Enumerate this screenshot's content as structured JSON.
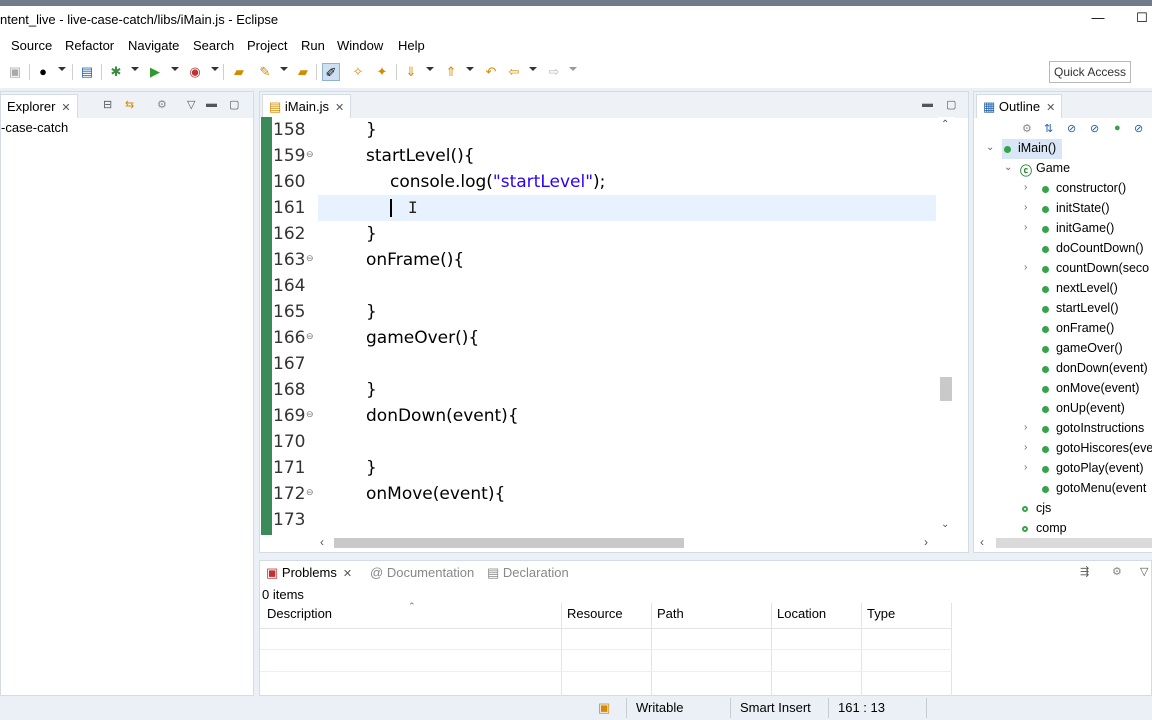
{
  "window": {
    "title": "ntent_live - live-case-catch/libs/iMain.js - Eclipse",
    "minimize_glyph": "—",
    "maximize_glyph": "☐"
  },
  "menu": [
    "Source",
    "Refactor",
    "Navigate",
    "Search",
    "Project",
    "Run",
    "Window",
    "Help"
  ],
  "toolbar": {
    "quick_access": "Quick Access"
  },
  "explorer": {
    "tab_label": "Explorer",
    "tree_item": "-case-catch"
  },
  "editor": {
    "tab_label": "iMain.js",
    "lines": [
      {
        "num": "158",
        "indent": 2,
        "parts": [
          {
            "t": "}"
          }
        ],
        "fold": false
      },
      {
        "num": "159",
        "indent": 2,
        "parts": [
          {
            "t": "startLevel(){"
          }
        ],
        "fold": true
      },
      {
        "num": "160",
        "indent": 3,
        "parts": [
          {
            "t": "console.log("
          },
          {
            "t": "\"startLevel\"",
            "s": true
          },
          {
            "t": ");"
          }
        ],
        "fold": false
      },
      {
        "num": "161",
        "indent": 3,
        "parts": [
          {
            "t": ""
          }
        ],
        "fold": false,
        "current": true
      },
      {
        "num": "162",
        "indent": 2,
        "parts": [
          {
            "t": "}"
          }
        ],
        "fold": false
      },
      {
        "num": "163",
        "indent": 2,
        "parts": [
          {
            "t": "onFrame(){"
          }
        ],
        "fold": true
      },
      {
        "num": "164",
        "indent": 2,
        "parts": [
          {
            "t": ""
          }
        ],
        "fold": false
      },
      {
        "num": "165",
        "indent": 2,
        "parts": [
          {
            "t": "}"
          }
        ],
        "fold": false
      },
      {
        "num": "166",
        "indent": 2,
        "parts": [
          {
            "t": "gameOver(){"
          }
        ],
        "fold": true
      },
      {
        "num": "167",
        "indent": 2,
        "parts": [
          {
            "t": ""
          }
        ],
        "fold": false
      },
      {
        "num": "168",
        "indent": 2,
        "parts": [
          {
            "t": "}"
          }
        ],
        "fold": false
      },
      {
        "num": "169",
        "indent": 2,
        "parts": [
          {
            "t": "donDown(event){"
          }
        ],
        "fold": true
      },
      {
        "num": "170",
        "indent": 2,
        "parts": [
          {
            "t": ""
          }
        ],
        "fold": false
      },
      {
        "num": "171",
        "indent": 2,
        "parts": [
          {
            "t": "}"
          }
        ],
        "fold": false
      },
      {
        "num": "172",
        "indent": 2,
        "parts": [
          {
            "t": "onMove(event){"
          }
        ],
        "fold": true
      },
      {
        "num": "173",
        "indent": 2,
        "parts": [
          {
            "t": ""
          }
        ],
        "fold": false
      }
    ]
  },
  "outline": {
    "tab_label": "Outline",
    "items": [
      {
        "label": "iMain()",
        "level": 0,
        "expand": "down",
        "selected": true
      },
      {
        "label": "Game",
        "level": 1,
        "expand": "down",
        "kind": "class"
      },
      {
        "label": "constructor()",
        "level": 2,
        "expand": "right"
      },
      {
        "label": "initState()",
        "level": 2,
        "expand": "right"
      },
      {
        "label": "initGame()",
        "level": 2,
        "expand": "right"
      },
      {
        "label": "doCountDown()",
        "level": 2,
        "expand": "none"
      },
      {
        "label": "countDown(seco",
        "level": 2,
        "expand": "right"
      },
      {
        "label": "nextLevel()",
        "level": 2,
        "expand": "none"
      },
      {
        "label": "startLevel()",
        "level": 2,
        "expand": "none"
      },
      {
        "label": "onFrame()",
        "level": 2,
        "expand": "none"
      },
      {
        "label": "gameOver()",
        "level": 2,
        "expand": "none"
      },
      {
        "label": "donDown(event)",
        "level": 2,
        "expand": "none"
      },
      {
        "label": "onMove(event)",
        "level": 2,
        "expand": "none"
      },
      {
        "label": "onUp(event)",
        "level": 2,
        "expand": "none"
      },
      {
        "label": "gotoInstructions",
        "level": 2,
        "expand": "right"
      },
      {
        "label": "gotoHiscores(eve",
        "level": 2,
        "expand": "right"
      },
      {
        "label": "gotoPlay(event)",
        "level": 2,
        "expand": "right"
      },
      {
        "label": "gotoMenu(event",
        "level": 2,
        "expand": "none"
      },
      {
        "label": "cjs",
        "level": 1,
        "expand": "none",
        "kind": "var"
      },
      {
        "label": "comp",
        "level": 1,
        "expand": "none",
        "kind": "var"
      }
    ]
  },
  "problems": {
    "tabs": [
      "Problems",
      "Documentation",
      "Declaration"
    ],
    "count": "0 items",
    "columns": [
      "Description",
      "Resource",
      "Path",
      "Location",
      "Type"
    ]
  },
  "status": {
    "writable": "Writable",
    "insert_mode": "Smart Insert",
    "position": "161 : 13"
  },
  "colors": {
    "accent": "#2a00ff",
    "current_line": "#e8f2fe",
    "selection": "#d9e6f5",
    "gutter_bar": "#3b8a5a"
  }
}
